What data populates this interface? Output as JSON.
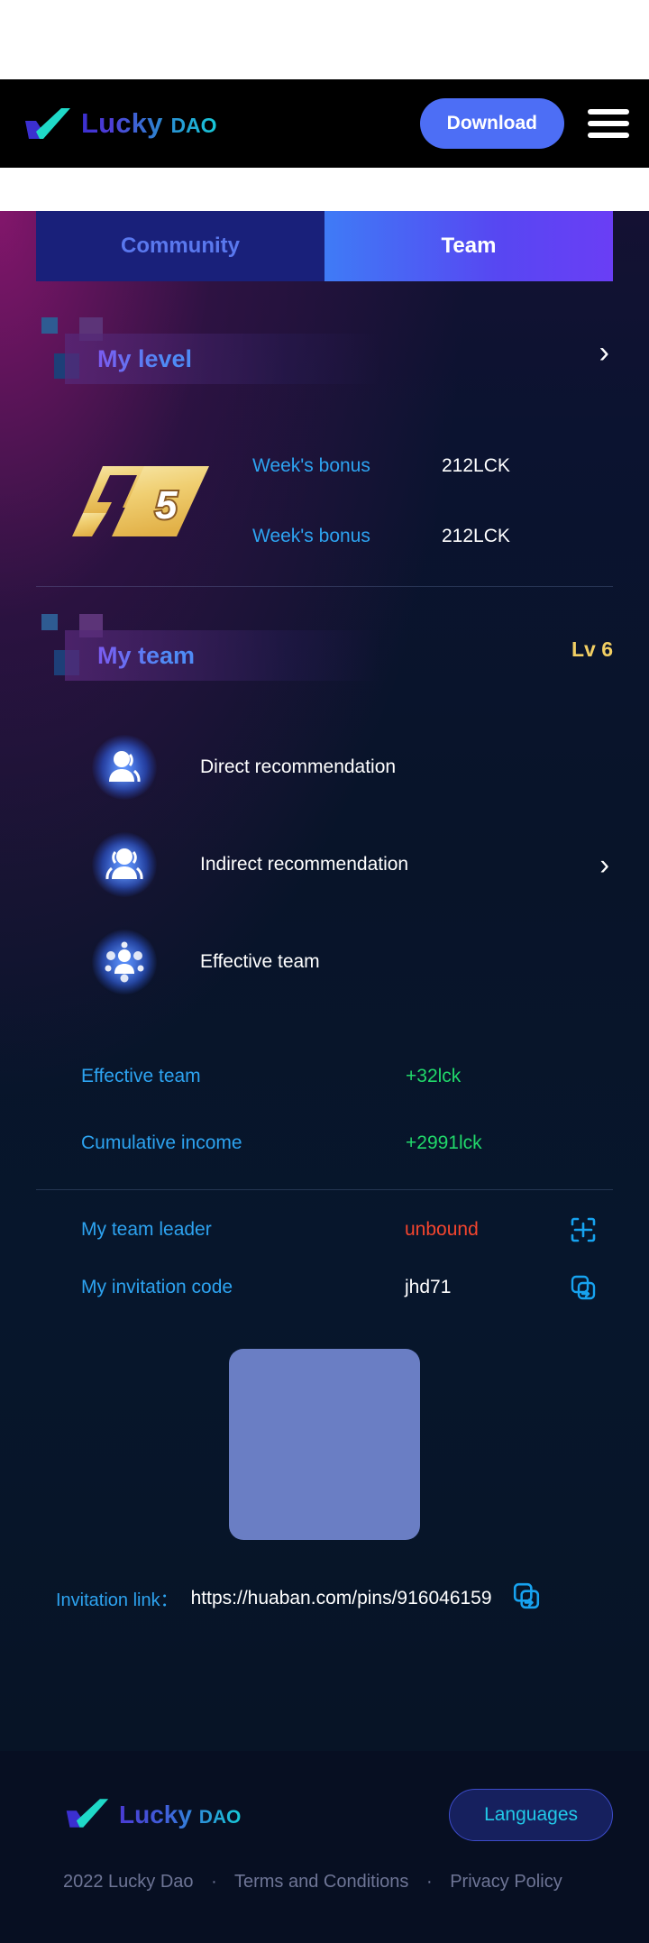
{
  "header": {
    "brand_main": "Lucky",
    "brand_sub": "DAO",
    "download_label": "Download",
    "menu_icon": "hamburger-menu-icon"
  },
  "tabs": [
    {
      "label": "Community",
      "active": false
    },
    {
      "label": "Team",
      "active": true
    }
  ],
  "my_level": {
    "title": "My level",
    "level_number": "5",
    "chevron": "›",
    "rows": [
      {
        "label": "Week's bonus",
        "value": "212LCK"
      },
      {
        "label": "Week's bonus",
        "value": "212LCK"
      }
    ]
  },
  "my_team": {
    "title": "My team",
    "level_badge": "Lv 6",
    "chevron": "›",
    "items": [
      {
        "label": "Direct recommendation",
        "icon": "single-user-icon",
        "has_chevron": false
      },
      {
        "label": "Indirect recommendation",
        "icon": "two-users-icon",
        "has_chevron": true
      },
      {
        "label": "Effective team",
        "icon": "team-network-icon",
        "has_chevron": false
      }
    ],
    "stats": [
      {
        "label": "Effective team",
        "value": "+32lck"
      },
      {
        "label": "Cumulative income",
        "value": "+2991lck"
      }
    ],
    "bindings": [
      {
        "label": "My team leader",
        "value": "unbound",
        "value_color": "red",
        "icon": "scan-qr-icon"
      },
      {
        "label": "My invitation code",
        "value": "jhd71",
        "value_color": "white",
        "icon": "copy-icon"
      }
    ],
    "qr_placeholder": "qr-code-placeholder"
  },
  "invitation": {
    "label": "Invitation link：",
    "url": "https://huaban.com/pins/916046159",
    "copy_icon": "copy-icon"
  },
  "footer": {
    "brand_main": "Lucky",
    "brand_sub": "DAO",
    "languages_label": "Languages",
    "copyright": "2022 Lucky Dao",
    "sep1": "·",
    "terms": "Terms and Conditions",
    "sep2": "·",
    "privacy": "Privacy Policy"
  },
  "colors": {
    "accent_blue": "#2da3f0",
    "green": "#21d86a",
    "red": "#f4452e",
    "gold": "#f2cf63",
    "tab_active": "#5747f2"
  }
}
